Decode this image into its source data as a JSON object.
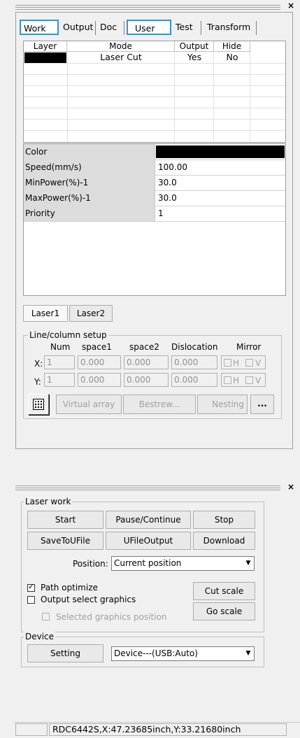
{
  "work_panel": {
    "tabs": [
      "Work",
      "Output",
      "Doc",
      "User",
      "Test",
      "Transform"
    ],
    "layer_table": {
      "columns": [
        "Layer",
        "Mode",
        "Output",
        "Hide"
      ],
      "rows": [
        {
          "layer_color": "#000000",
          "mode": "Laser Cut",
          "output": "Yes",
          "hide": "No"
        }
      ]
    },
    "properties": [
      {
        "name": "Color",
        "value": "",
        "color": "#000000"
      },
      {
        "name": "Speed(mm/s)",
        "value": "100.00"
      },
      {
        "name": "MinPower(%)-1",
        "value": "30.0"
      },
      {
        "name": "MaxPower(%)-1",
        "value": "30.0"
      },
      {
        "name": "Priority",
        "value": "1"
      }
    ],
    "laser_buttons": [
      "Laser1",
      "Laser2"
    ],
    "line_column": {
      "title": "Line/column setup",
      "headers": [
        "Num",
        "space1",
        "space2",
        "Dislocation",
        "Mirror"
      ],
      "x_label": "X:",
      "y_label": "Y:",
      "x": {
        "num": "1",
        "space1": "0.000",
        "space2": "0.000",
        "dislocation": "0.000"
      },
      "y": {
        "num": "1",
        "space1": "0.000",
        "space2": "0.000",
        "dislocation": "0.000"
      },
      "mirror_h": "H",
      "mirror_v": "V"
    },
    "array_buttons": {
      "virtual_array": "Virtual array",
      "bestrew": "Bestrew...",
      "nesting": "Nesting",
      "more": "..."
    }
  },
  "laser_work_panel": {
    "title": "Laser work",
    "buttons": {
      "start": "Start",
      "pause": "Pause/Continue",
      "stop": "Stop",
      "save_u": "SaveToUFile",
      "ufile_output": "UFileOutput",
      "download": "Download",
      "cut_scale": "Cut scale",
      "go_scale": "Go scale"
    },
    "position_label": "Position:",
    "position_value": "Current position",
    "path_optimize": {
      "label": "Path optimize",
      "checked": true
    },
    "output_select": {
      "label": "Output select graphics",
      "checked": false
    },
    "selected_pos": {
      "label": "Selected graphics position",
      "checked": false
    },
    "device_group": "Device",
    "setting": "Setting",
    "device_value": "Device---(USB:Auto)"
  },
  "status_bar": {
    "text": "RDC6442S,X:47.23685inch,Y:33.21680inch"
  }
}
